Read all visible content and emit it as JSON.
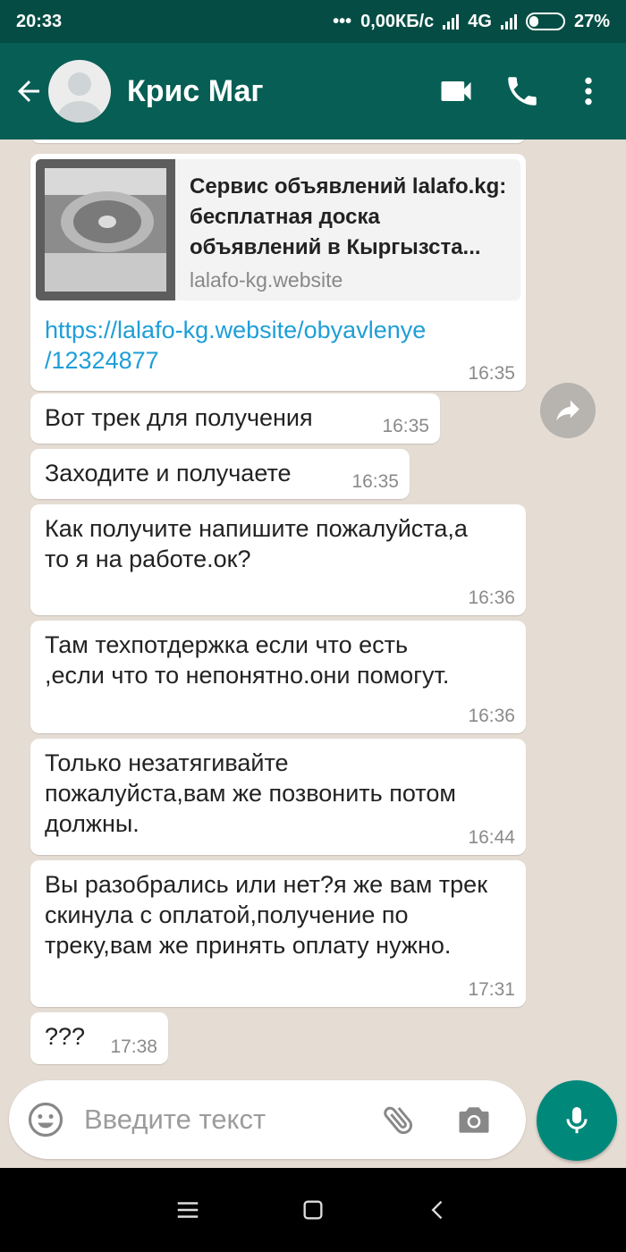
{
  "status_bar": {
    "time": "20:33",
    "dots": "•••",
    "network_speed": "0,00КБ/с",
    "network_type": "4G",
    "battery": "27%",
    "battery_level": 0.27
  },
  "header": {
    "contact_name": "Крис Маг",
    "accent_color": "#075e54",
    "icons": [
      "back-arrow-icon",
      "avatar",
      "video-call-icon",
      "phone-icon",
      "more-options-icon"
    ]
  },
  "messages": [
    {
      "type": "link",
      "preview_title": "Сервис объявлений lalafo.kg: бесплатная доска объявлений в Кыргызста...",
      "preview_domain": "lalafo-kg.website",
      "url_line1": "https://lalafo-kg.website/obyavlenye",
      "url_line2": "/12324877",
      "time": "16:35"
    },
    {
      "text": "Вот трек для получения",
      "time": "16:35"
    },
    {
      "text": "Заходите и получаете",
      "time": "16:35"
    },
    {
      "text": "Как получите напишите пожалуйста,а то я на работе.ок?",
      "time": "16:36"
    },
    {
      "text": "Там техпотдержка если что есть ,если что то непонятно.они помогут.",
      "time": "16:36"
    },
    {
      "text": "Только незатягивайте пожалуйста,вам же позвонить потом должны.",
      "time": "16:44"
    },
    {
      "text": "Вы разобрались или нет?я же вам трек скинула с оплатой,получение по треку,вам же принять оплату нужно.",
      "time": "17:31"
    },
    {
      "text": "???",
      "time": "17:38"
    }
  ],
  "input": {
    "placeholder": "Введите текст",
    "value": ""
  },
  "colors": {
    "link": "#1e9ed8",
    "mic_button": "#00897b",
    "chat_bg": "#e5dcd3"
  }
}
